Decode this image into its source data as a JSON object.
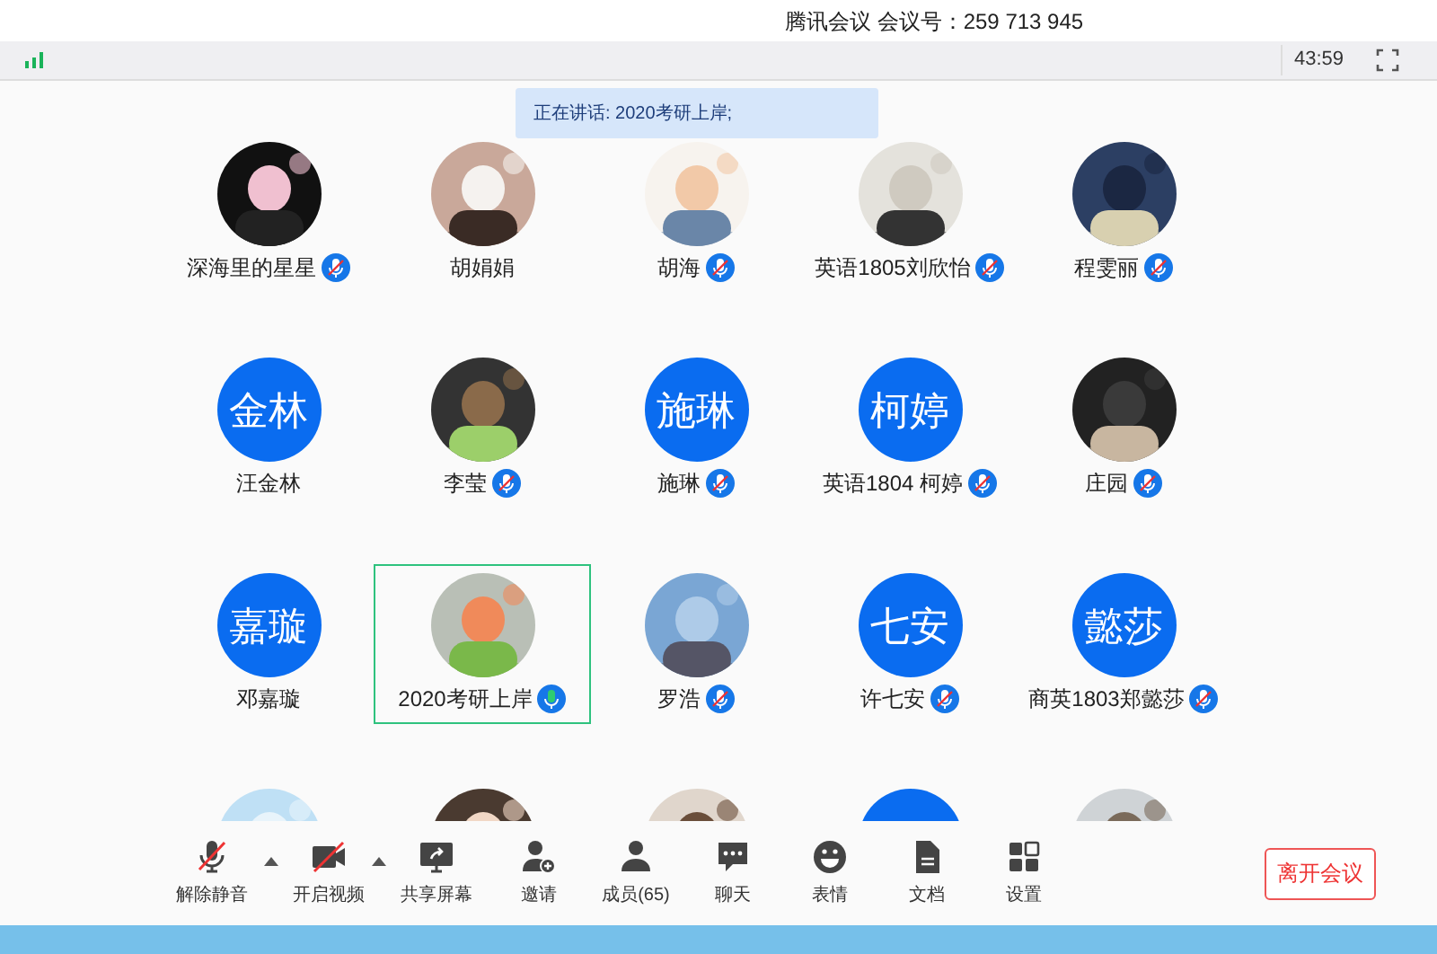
{
  "window": {
    "title": "腾讯会议 会议号：259 713 945"
  },
  "status_bar": {
    "timer": "43:59"
  },
  "speaking_banner": "正在讲话: 2020考研上岸;",
  "participants": [
    {
      "name": "深海里的星星",
      "kind": "picture",
      "muted": true,
      "selected": false
    },
    {
      "name": "胡娟娟",
      "kind": "picture",
      "selected": false
    },
    {
      "name": "胡海",
      "kind": "picture",
      "muted": true,
      "selected": false
    },
    {
      "name": "英语1805刘欣怡",
      "kind": "picture",
      "muted": true,
      "selected": false
    },
    {
      "name": "程雯丽",
      "kind": "picture",
      "muted": true,
      "selected": false
    },
    {
      "name": "汪金林",
      "kind": "initials",
      "initials": "金林",
      "selected": false
    },
    {
      "name": "李莹",
      "kind": "picture",
      "muted": true,
      "selected": false
    },
    {
      "name": "施琳",
      "kind": "initials",
      "initials": "施琳",
      "muted": true,
      "selected": false
    },
    {
      "name": "英语1804 柯婷",
      "kind": "initials",
      "initials": "柯婷",
      "muted": true,
      "selected": false
    },
    {
      "name": "庄园",
      "kind": "picture",
      "muted": true,
      "selected": false
    },
    {
      "name": "邓嘉璇",
      "kind": "initials",
      "initials": "嘉璇",
      "selected": false
    },
    {
      "name": "2020考研上岸",
      "kind": "picture",
      "muted": false,
      "selected": true
    },
    {
      "name": "罗浩",
      "kind": "picture",
      "muted": true,
      "selected": false
    },
    {
      "name": "许七安",
      "kind": "initials",
      "initials": "七安",
      "muted": true,
      "selected": false
    },
    {
      "name": "商英1803郑懿莎",
      "kind": "initials",
      "initials": "懿莎",
      "muted": true,
      "selected": false
    },
    {
      "kind": "picture"
    },
    {
      "kind": "picture"
    },
    {
      "kind": "picture"
    },
    {
      "kind": "blank"
    },
    {
      "kind": "picture"
    }
  ],
  "toolbar": [
    {
      "label": "解除静音",
      "menu": true
    },
    {
      "label": "开启视频",
      "menu": true
    },
    {
      "label": "共享屏幕",
      "menu": false
    },
    {
      "label": "邀请",
      "menu": false
    },
    {
      "label": "成员(65)",
      "menu": false
    },
    {
      "label": "聊天",
      "menu": false
    },
    {
      "label": "表情",
      "menu": false
    },
    {
      "label": "文档",
      "menu": false
    },
    {
      "label": "设置",
      "menu": false
    }
  ],
  "leave_button": "离开会议"
}
